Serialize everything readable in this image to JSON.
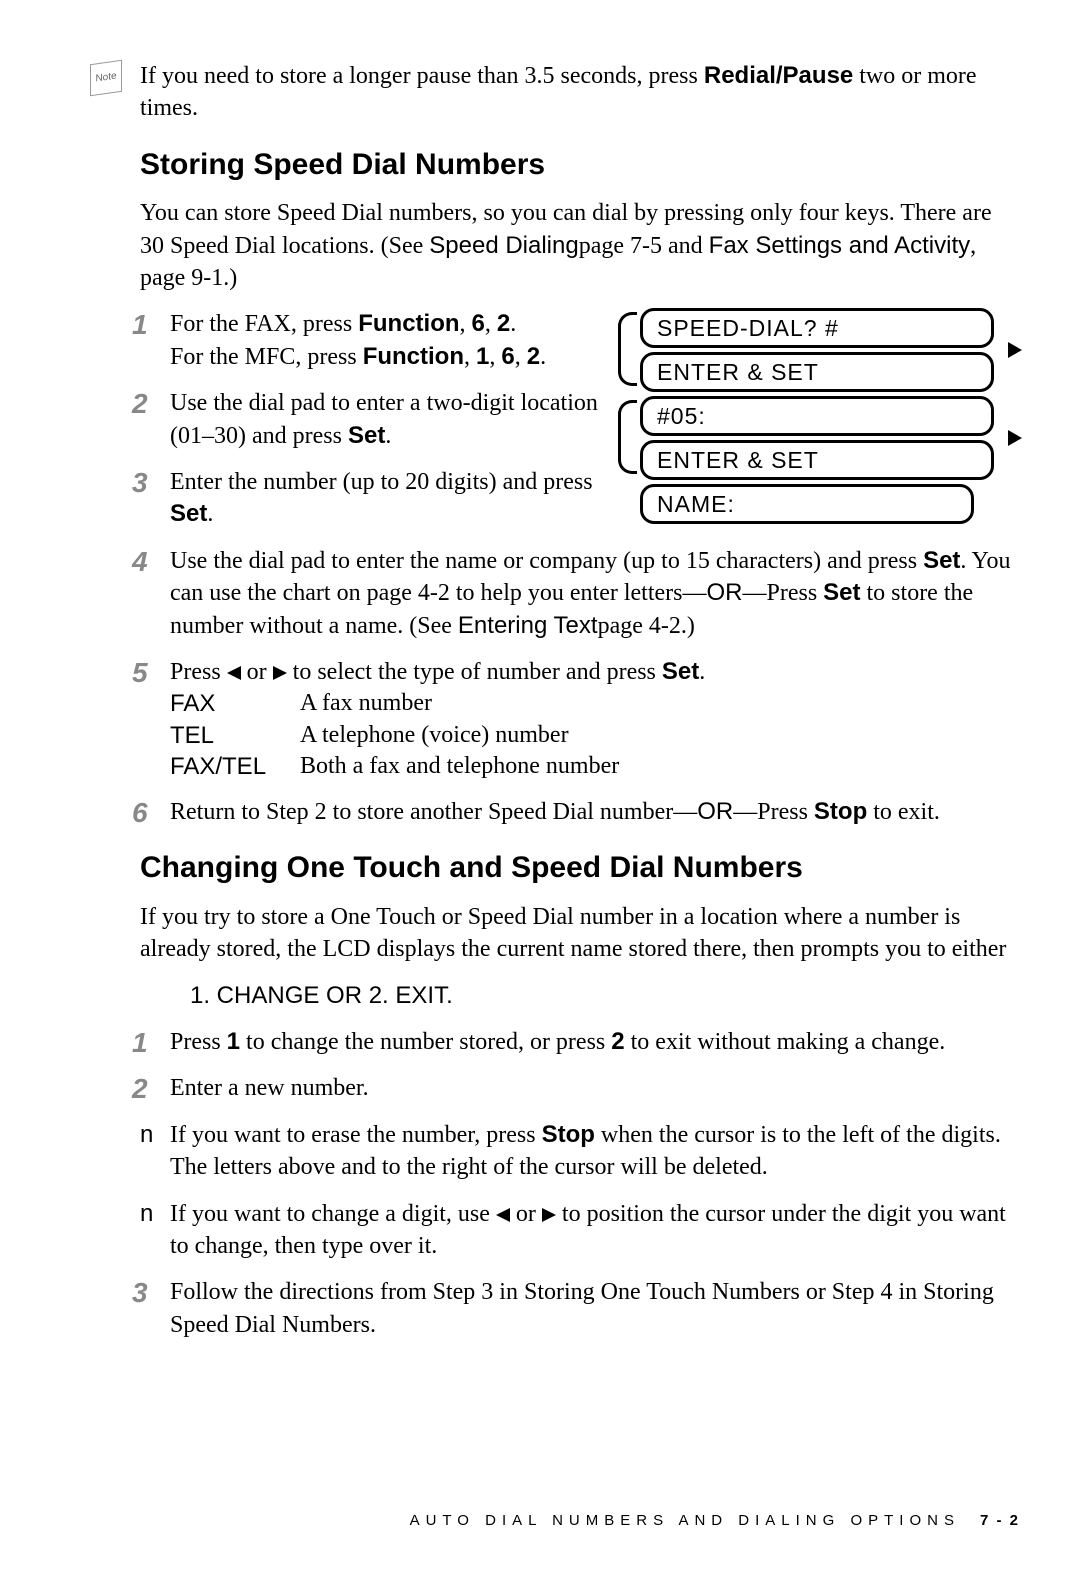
{
  "note": {
    "icon_label": "Note",
    "text_pre": "If you need to store a longer pause than 3.5 seconds, press ",
    "button": "Redial/Pause",
    "text_post": " two or more times."
  },
  "section1": {
    "heading": "Storing Speed Dial Numbers",
    "intro_pre": "You can store Speed Dial numbers, so you can dial by pressing only four keys. There are 30 Speed Dial locations. (See ",
    "link1": "Speed Dialing",
    "intro_mid": "page 7-5 and ",
    "link2": "Fax Settings and Activity",
    "intro_post": ", page 9-1.)",
    "lcd": {
      "l1": "SPEED-DIAL? #",
      "l2": "ENTER & SET",
      "l3": "#05:",
      "l4": "ENTER & SET",
      "l5": "NAME:"
    },
    "steps": {
      "s1a": "For the FAX, press ",
      "s1_fn": "Function",
      "s1b": ", ",
      "s1_k1": "6",
      "s1_k2": "2",
      "s1c": ".",
      "s1d": "For the MFC, press ",
      "s1_k3": "1",
      "s2a": "Use the dial pad to enter a two-digit location (01–30) and press ",
      "s2_set": "Set",
      "s2b": ".",
      "s3a": "Enter the number (up to 20 digits) and press ",
      "s3_set": "Set",
      "s3b": ".",
      "s4a": "Use the dial pad to enter the name or company (up to 15 characters) and press ",
      "s4_set1": "Set",
      "s4b": ". You can use the chart on page 4-2 to help you enter letters—",
      "s4_or": "OR",
      "s4c": "—Press ",
      "s4_set2": "Set",
      "s4d": " to store the number without a name. (See ",
      "s4_link": "Entering Text",
      "s4e": "page 4-2.)",
      "s5a": "Press ",
      "s5b": " or ",
      "s5c": " to select the type of number and press ",
      "s5_set": "Set",
      "s5d": ".",
      "types": {
        "fax_label": "FAX",
        "fax_desc": "A fax number",
        "tel_label": "TEL",
        "tel_desc": "A telephone (voice) number",
        "ft_label": "FAX/TEL",
        "ft_desc": "Both a fax and telephone number"
      },
      "s6a": "Return to Step 2 to store another Speed Dial number—",
      "s6_or": "OR",
      "s6b": "—Press ",
      "s6_stop": "Stop",
      "s6c": " to exit."
    }
  },
  "section2": {
    "heading": "Changing One Touch and Speed Dial Numbers",
    "intro": "If you try to store a One Touch or Speed Dial number in a location where a number is already stored, the LCD displays the current name stored there, then prompts you to either",
    "choice": "1. CHANGE OR 2. EXIT.",
    "steps": {
      "s1a": "Press ",
      "s1_k1": "1",
      "s1b": " to change the number stored, or press ",
      "s1_k2": "2",
      "s1c": " to exit without making a change.",
      "s2": "Enter a new number.",
      "b1a": "If you want to erase the number, press ",
      "b1_stop": "Stop",
      "b1b": " when the cursor is to the left of the digits. The letters above and to the right of the cursor will be deleted.",
      "b2a": "If you want to change a digit, use ",
      "b2b": " or ",
      "b2c": " to position the cursor under the digit you want to change, then type over it.",
      "s3": "Follow the directions from Step 3 in Storing One Touch Numbers or Step 4 in Storing Speed Dial Numbers."
    }
  },
  "footer": {
    "text": "AUTO DIAL NUMBERS AND DIALING OPTIONS",
    "page": "7 - 2"
  }
}
